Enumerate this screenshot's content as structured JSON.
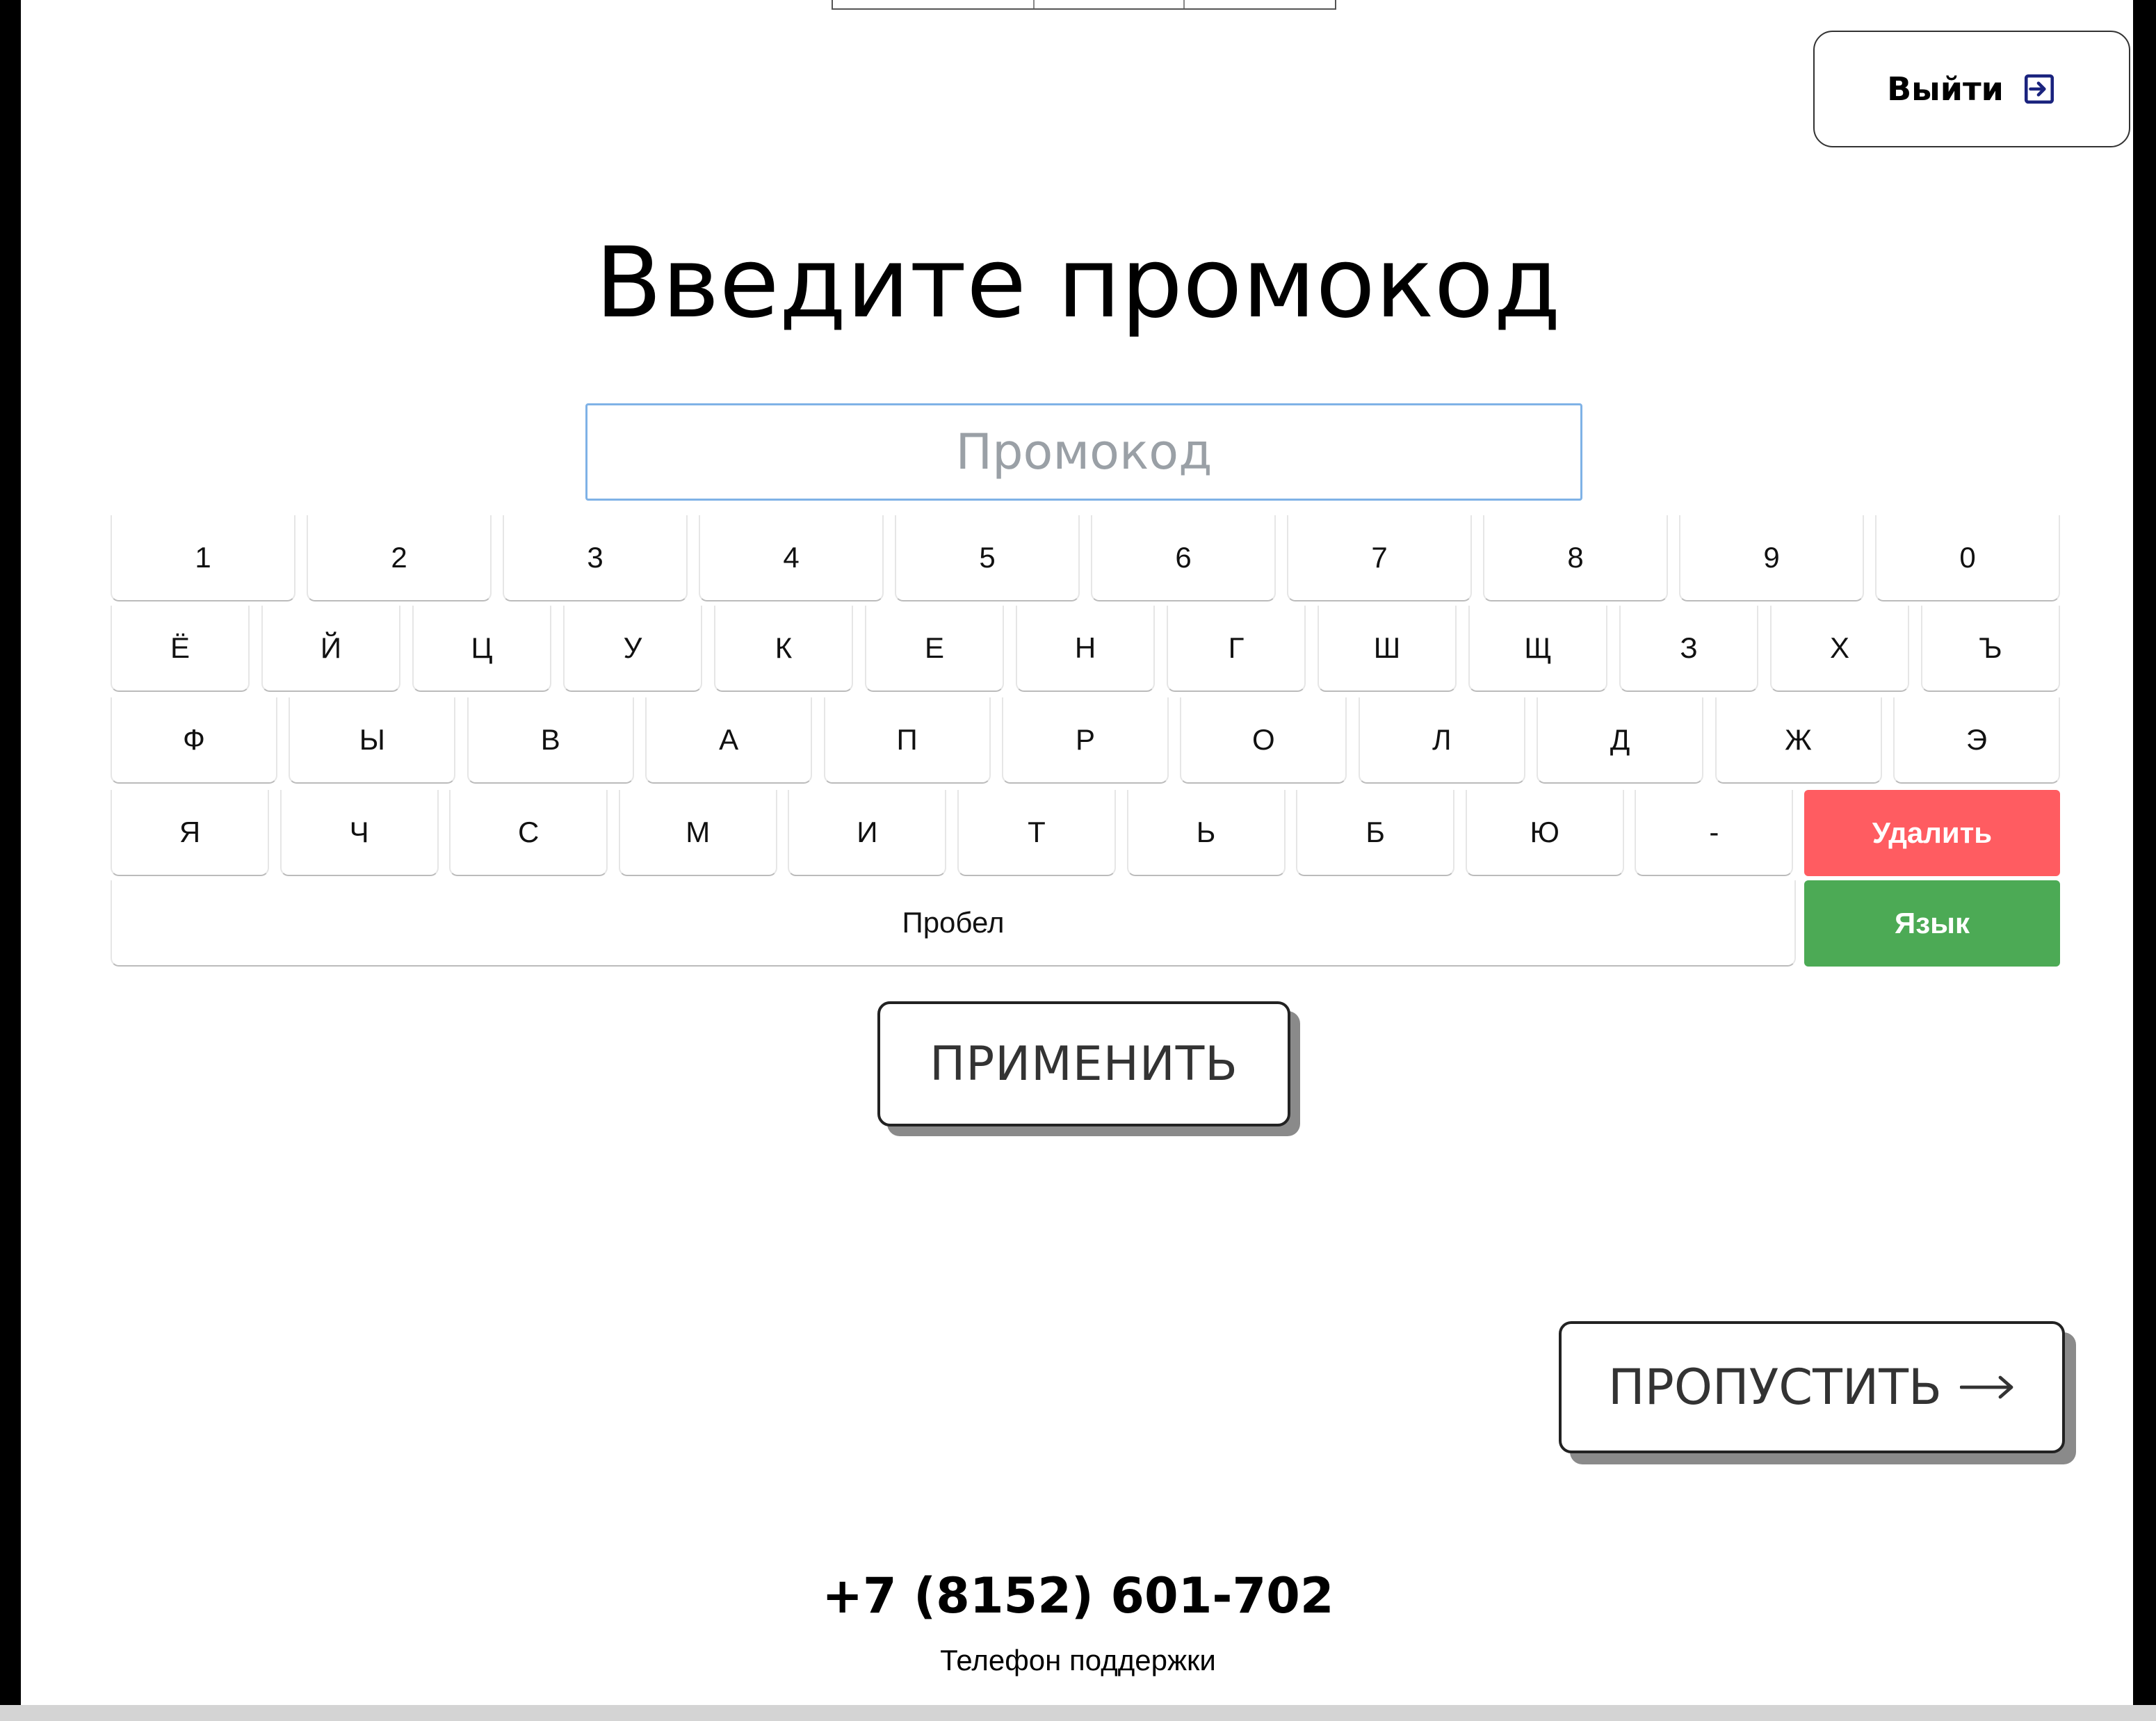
{
  "header": {
    "exit_label": "Выйти",
    "exit_icon": "logout-icon"
  },
  "title": "Введите промокод",
  "promo_input": {
    "placeholder": "Промокод",
    "value": ""
  },
  "keyboard": {
    "digits": [
      "1",
      "2",
      "3",
      "4",
      "5",
      "6",
      "7",
      "8",
      "9",
      "0"
    ],
    "row1": [
      "Ё",
      "Й",
      "Ц",
      "У",
      "К",
      "Е",
      "Н",
      "Г",
      "Ш",
      "Щ",
      "З",
      "Х",
      "Ъ"
    ],
    "row2": [
      "Ф",
      "Ы",
      "В",
      "А",
      "П",
      "Р",
      "О",
      "Л",
      "Д",
      "Ж",
      "Э"
    ],
    "row3": [
      "Я",
      "Ч",
      "С",
      "М",
      "И",
      "Т",
      "Ь",
      "Б",
      "Ю",
      "-"
    ],
    "delete_label": "Удалить",
    "space_label": "Пробел",
    "language_label": "Язык",
    "delete_color": "#ff5c61",
    "language_color": "#4caa55"
  },
  "apply_label": "ПРИМЕНИТЬ",
  "skip_label": "ПРОПУСТИТЬ",
  "skip_icon": "arrow-right-icon",
  "support": {
    "phone": "+7 (8152) 601-702",
    "caption": "Телефон поддержки"
  }
}
